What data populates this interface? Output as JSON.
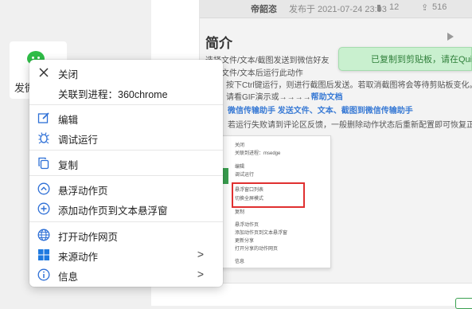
{
  "background": {
    "author": "帝韶恣",
    "timestamp": "发布于 2021-07-24 23:03",
    "like_count": "12",
    "share_count": "516",
    "intro_title": "简介",
    "intro_lines": [
      "选择文件/文本/截图发送到微信好友",
      "文件/文本后运行此动作",
      "按下Ctrl键运行，则进行截图后发送。若取消截图将会等待剪贴板变化。若有",
      "请看GIF演示或→→→→",
      "微信传输助手 发送文件、文本、截图到微信传输助手",
      "若运行失败请到评论区反馈，一般删除动作状态后重新配置即可恢复正常"
    ],
    "help_link": "帮助文档",
    "toast": "已复制到剪贴板，请在Quic"
  },
  "mini_menu": {
    "rows": [
      "关闭",
      "关联到进程：msedge",
      "编辑",
      "调试运行",
      "悬浮窗口列表",
      "切换全屏模式",
      "复制",
      "悬浮动作页",
      "添加动作页到文本悬浮窗",
      "更新分享",
      "打开分享的动作网页",
      "信息"
    ]
  },
  "action_tile": {
    "label": "发微",
    "icon": "wechat-icon"
  },
  "menu": {
    "items": [
      {
        "label": "关闭",
        "icon": "close-icon"
      },
      {
        "label": "关联到进程：360chrome",
        "icon": ""
      },
      {
        "label": "编辑",
        "icon": "edit-icon"
      },
      {
        "label": "调试运行",
        "icon": "bug-icon"
      },
      {
        "label": "复制",
        "icon": "copy-icon"
      },
      {
        "label": "悬浮动作页",
        "icon": "chevron-up-circle-icon"
      },
      {
        "label": "添加动作页到文本悬浮窗",
        "icon": "plus-circle-icon"
      },
      {
        "label": "打开动作网页",
        "icon": "globe-icon"
      },
      {
        "label": "来源动作",
        "icon": "windows-icon"
      },
      {
        "label": "信息",
        "icon": "info-icon"
      }
    ],
    "submenu_arrow": ">"
  },
  "colors": {
    "accent": "#3a7bd5",
    "icon_blue": "#2d6fd6",
    "wechat_green": "#2fbd47",
    "toast_bg": "#c9f0cf",
    "highlight_red": "#e03030"
  }
}
